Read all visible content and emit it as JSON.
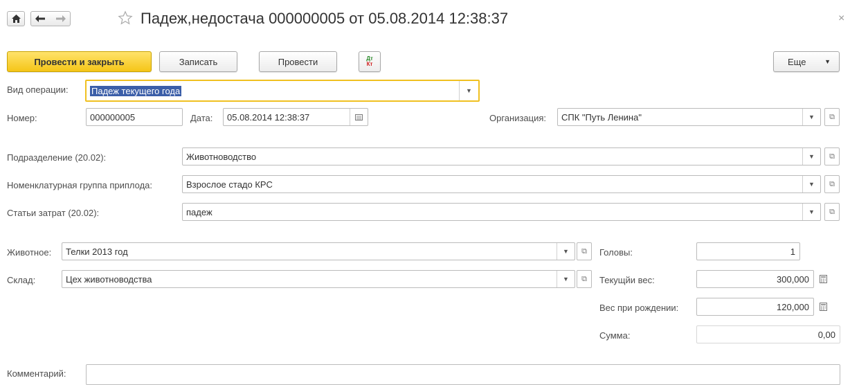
{
  "header": {
    "title": "Падеж,недостача 000000005 от 05.08.2014 12:38:37",
    "close_glyph": "×"
  },
  "toolbar": {
    "post_close_label": "Провести и закрыть",
    "save_label": "Записать",
    "post_label": "Провести",
    "dtkt_label_top": "Дт",
    "dtkt_label_bottom": "Кт",
    "more_label": "Еще"
  },
  "form": {
    "operation_label": "Вид операции:",
    "operation_value": "Падеж текущего года",
    "number_label": "Номер:",
    "number_value": "000000005",
    "date_label": "Дата:",
    "date_value": "05.08.2014 12:38:37",
    "org_label": "Организация:",
    "org_value": "СПК \"Путь Ленина\"",
    "division_label": "Подразделение (20.02):",
    "division_value": "Животноводство",
    "nomgroup_label": "Номенклатурная группа приплода:",
    "nomgroup_value": "Взрослое стадо КРС",
    "cost_label": "Статьи затрат (20.02):",
    "cost_value": "падеж",
    "animal_label": "Животное:",
    "animal_value": "Телки 2013 год",
    "warehouse_label": "Склад:",
    "warehouse_value": "Цех животноводства",
    "heads_label": "Головы:",
    "heads_value": "1",
    "weight_label": "Текущйи вес:",
    "weight_value": "300,000",
    "birth_weight_label": "Вес при рождении:",
    "birth_weight_value": "120,000",
    "sum_label": "Сумма:",
    "sum_value": "0,00",
    "comment_label": "Комментарий:",
    "comment_value": ""
  },
  "icons": {
    "home": "home-icon",
    "back": "arrow-left-icon",
    "forward": "arrow-right-icon",
    "star": "star-icon",
    "dropdown": "chevron-down-icon",
    "open": "open-form-icon",
    "calendar": "calendar-icon",
    "calculator": "calculator-icon"
  },
  "colors": {
    "primary_button": "#f5c518",
    "focus_border": "#f0c020",
    "selection": "#3b5ea8"
  }
}
